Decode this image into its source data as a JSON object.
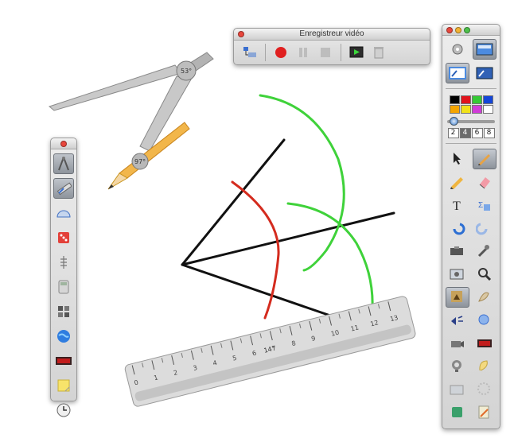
{
  "recorder": {
    "title": "Enregistreur vidéo",
    "buttons": [
      "settings",
      "record",
      "pause",
      "stop",
      "play",
      "trash"
    ]
  },
  "compass": {
    "angle_label": "53°",
    "pencil_angle_label": "97°"
  },
  "ruler": {
    "angle_label": "14°",
    "numbers": [
      "0",
      "1",
      "2",
      "3",
      "4",
      "5",
      "6",
      "7",
      "8",
      "9",
      "10",
      "11",
      "12",
      "13"
    ]
  },
  "left_palette": {
    "tools": [
      "compass-tool-icon",
      "ruler-tool-icon",
      "protractor-icon",
      "dice-icon",
      "number-line-icon",
      "calculator-icon",
      "tiles-icon",
      "globe-icon",
      "counter-display-icon",
      "sticky-note-icon",
      "clock-icon"
    ]
  },
  "right_palette": {
    "color_swatches": [
      "#000000",
      "#e0141c",
      "#35c935",
      "#1446d8",
      "#f5a500",
      "#f1e21a",
      "#d13bd8",
      "#ffffff"
    ],
    "line_sizes": [
      "2",
      "4",
      "6",
      "8"
    ],
    "selected_size": "4",
    "tools": [
      [
        "pointer-icon",
        "pen-icon"
      ],
      [
        "pencil-icon",
        "eraser-icon"
      ],
      [
        "text-tool-icon",
        "formula-icon"
      ],
      [
        "undo-icon",
        "redo-icon"
      ],
      [
        "toolbox-icon",
        "wrench-icon"
      ],
      [
        "image-capture-icon",
        "zoom-icon"
      ],
      [
        "stamp-icon",
        "mask-icon"
      ],
      [
        "speaker-icon",
        "fill-icon"
      ],
      [
        "camera-icon",
        "display-icon"
      ],
      [
        "trophy-icon",
        "attach-icon"
      ],
      [
        "folder-icon",
        "spinner-icon"
      ],
      [
        "box-icon",
        "notes-icon"
      ]
    ]
  }
}
